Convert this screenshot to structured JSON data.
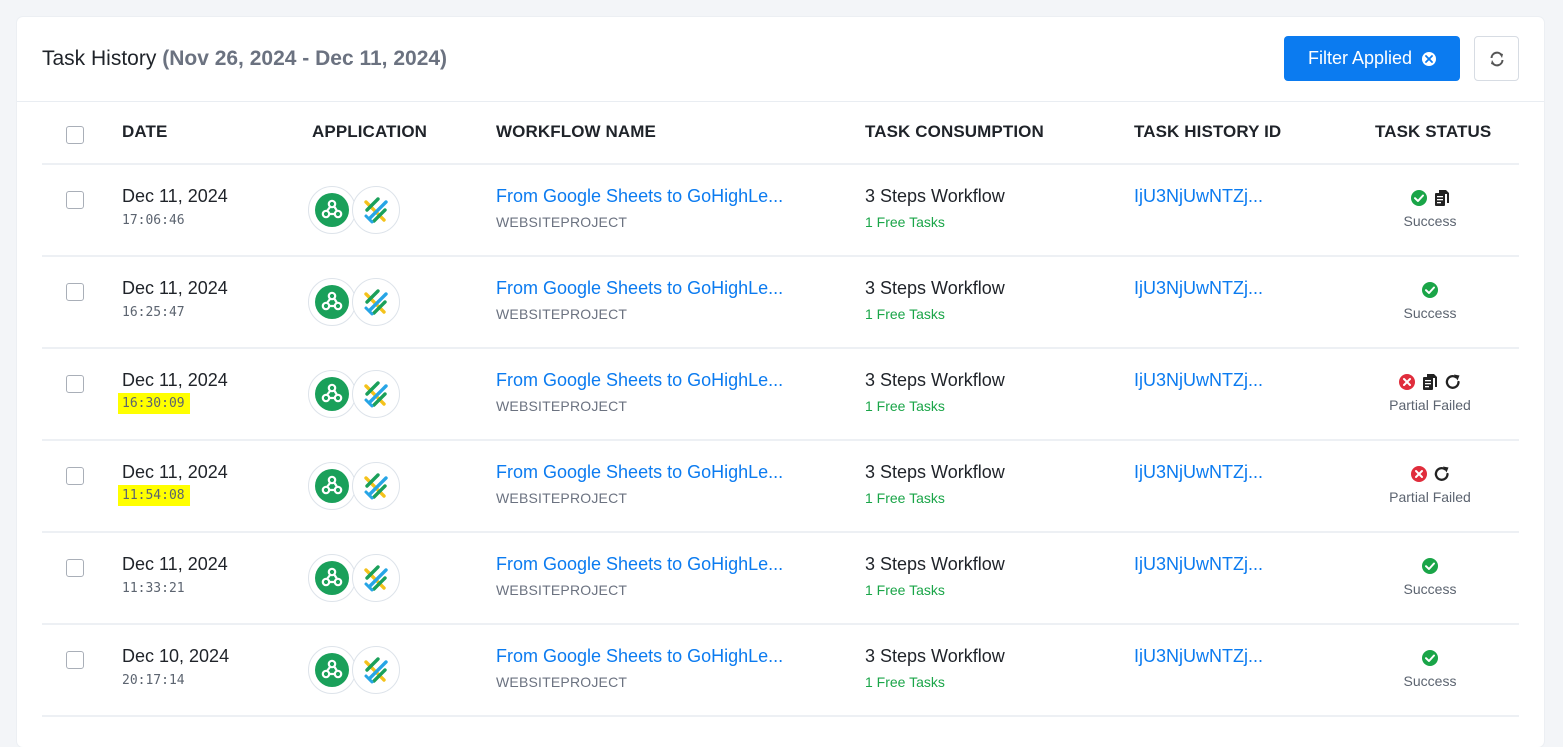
{
  "header": {
    "title": "Task History",
    "date_range": "(Nov 26, 2024 - Dec 11, 2024)",
    "filter_button": "Filter Applied",
    "accent_color": "#0b7bf0"
  },
  "columns": [
    "DATE",
    "APPLICATION",
    "WORKFLOW NAME",
    "TASK CONSUMPTION",
    "TASK HISTORY ID",
    "TASK STATUS"
  ],
  "rows": [
    {
      "date": "Dec 11, 2024",
      "time": "17:06:46",
      "highlight": false,
      "workflow": "From Google Sheets to GoHighLe...",
      "project": "WEBSITEPROJECT",
      "steps": "3 Steps Workflow",
      "tasks": "1 Free Tasks",
      "id": "IjU3NjUwNTZj...",
      "status": "Success",
      "status_icons": [
        "check-icon",
        "copy-icon"
      ]
    },
    {
      "date": "Dec 11, 2024",
      "time": "16:25:47",
      "highlight": false,
      "workflow": "From Google Sheets to GoHighLe...",
      "project": "WEBSITEPROJECT",
      "steps": "3 Steps Workflow",
      "tasks": "1 Free Tasks",
      "id": "IjU3NjUwNTZj...",
      "status": "Success",
      "status_icons": [
        "check-icon"
      ]
    },
    {
      "date": "Dec 11, 2024",
      "time": "16:30:09",
      "highlight": true,
      "workflow": "From Google Sheets to GoHighLe...",
      "project": "WEBSITEPROJECT",
      "steps": "3 Steps Workflow",
      "tasks": "1 Free Tasks",
      "id": "IjU3NjUwNTZj...",
      "status": "Partial Failed",
      "status_icons": [
        "error-icon",
        "copy-icon",
        "retry-icon"
      ]
    },
    {
      "date": "Dec 11, 2024",
      "time": "11:54:08",
      "highlight": true,
      "workflow": "From Google Sheets to GoHighLe...",
      "project": "WEBSITEPROJECT",
      "steps": "3 Steps Workflow",
      "tasks": "1 Free Tasks",
      "id": "IjU3NjUwNTZj...",
      "status": "Partial Failed",
      "status_icons": [
        "error-icon",
        "retry-icon"
      ]
    },
    {
      "date": "Dec 11, 2024",
      "time": "11:33:21",
      "highlight": false,
      "workflow": "From Google Sheets to GoHighLe...",
      "project": "WEBSITEPROJECT",
      "steps": "3 Steps Workflow",
      "tasks": "1 Free Tasks",
      "id": "IjU3NjUwNTZj...",
      "status": "Success",
      "status_icons": [
        "check-icon"
      ]
    },
    {
      "date": "Dec 10, 2024",
      "time": "20:17:14",
      "highlight": false,
      "workflow": "From Google Sheets to GoHighLe...",
      "project": "WEBSITEPROJECT",
      "steps": "3 Steps Workflow",
      "tasks": "1 Free Tasks",
      "id": "IjU3NjUwNTZj...",
      "status": "Success",
      "status_icons": [
        "check-icon"
      ]
    }
  ]
}
